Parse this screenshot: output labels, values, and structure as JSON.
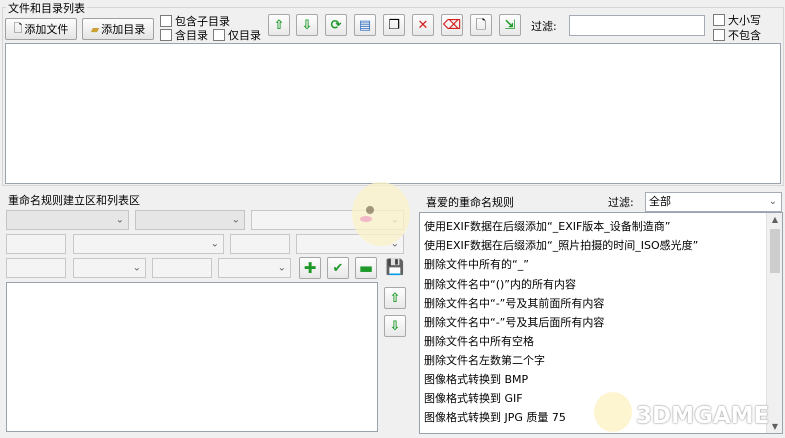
{
  "top": {
    "section_title": "文件和目录列表",
    "add_file_label": "添加文件",
    "add_dir_label": "添加目录",
    "include_subdir_label": "包含子目录",
    "with_dir_label": "含目录",
    "only_dir_label": "仅目录",
    "filter_label": "过滤:",
    "filter_value": "",
    "case_label": "大小写",
    "exclude_label": "不包含"
  },
  "toolbar": {
    "icons": [
      "up-arrow-icon",
      "down-arrow-icon",
      "refresh-icon",
      "document-icon",
      "copy-icon",
      "delete-icon",
      "clear-icon",
      "file-icon",
      "export-icon"
    ]
  },
  "rules_area": {
    "section_title": "重命名规则建立区和列表区"
  },
  "favorites": {
    "section_title": "喜爱的重命名规则",
    "filter_label": "过滤:",
    "filter_value": "全部",
    "items": [
      "使用EXIF数据在后缀添加“_EXIF版本_设备制造商”",
      "使用EXIF数据在后缀添加“_照片拍摄的时间_ISO感光度”",
      "删除文件中所有的“_”",
      "删除文件名中“()”内的所有内容",
      "删除文件名中“-”号及其前面所有内容",
      "删除文件名中“-”号及其后面所有内容",
      "删除文件名中所有空格",
      "删除文件名左数第二个字",
      "图像格式转换到 BMP",
      "图像格式转换到 GIF",
      "图像格式转换到 JPG 质量 75"
    ]
  },
  "watermark": {
    "text": "3DMGAME"
  },
  "colors": {
    "accent_green": "#1f9a2a",
    "accent_red": "#d42020",
    "accent_blue": "#2d6fc0"
  }
}
